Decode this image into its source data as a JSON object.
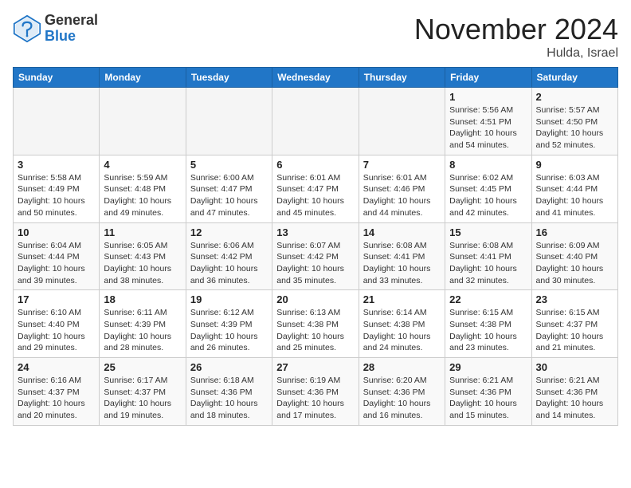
{
  "logo": {
    "general": "General",
    "blue": "Blue"
  },
  "title": "November 2024",
  "location": "Hulda, Israel",
  "days_of_week": [
    "Sunday",
    "Monday",
    "Tuesday",
    "Wednesday",
    "Thursday",
    "Friday",
    "Saturday"
  ],
  "weeks": [
    [
      {
        "day": "",
        "info": ""
      },
      {
        "day": "",
        "info": ""
      },
      {
        "day": "",
        "info": ""
      },
      {
        "day": "",
        "info": ""
      },
      {
        "day": "",
        "info": ""
      },
      {
        "day": "1",
        "info": "Sunrise: 5:56 AM\nSunset: 4:51 PM\nDaylight: 10 hours and 54 minutes."
      },
      {
        "day": "2",
        "info": "Sunrise: 5:57 AM\nSunset: 4:50 PM\nDaylight: 10 hours and 52 minutes."
      }
    ],
    [
      {
        "day": "3",
        "info": "Sunrise: 5:58 AM\nSunset: 4:49 PM\nDaylight: 10 hours and 50 minutes."
      },
      {
        "day": "4",
        "info": "Sunrise: 5:59 AM\nSunset: 4:48 PM\nDaylight: 10 hours and 49 minutes."
      },
      {
        "day": "5",
        "info": "Sunrise: 6:00 AM\nSunset: 4:47 PM\nDaylight: 10 hours and 47 minutes."
      },
      {
        "day": "6",
        "info": "Sunrise: 6:01 AM\nSunset: 4:47 PM\nDaylight: 10 hours and 45 minutes."
      },
      {
        "day": "7",
        "info": "Sunrise: 6:01 AM\nSunset: 4:46 PM\nDaylight: 10 hours and 44 minutes."
      },
      {
        "day": "8",
        "info": "Sunrise: 6:02 AM\nSunset: 4:45 PM\nDaylight: 10 hours and 42 minutes."
      },
      {
        "day": "9",
        "info": "Sunrise: 6:03 AM\nSunset: 4:44 PM\nDaylight: 10 hours and 41 minutes."
      }
    ],
    [
      {
        "day": "10",
        "info": "Sunrise: 6:04 AM\nSunset: 4:44 PM\nDaylight: 10 hours and 39 minutes."
      },
      {
        "day": "11",
        "info": "Sunrise: 6:05 AM\nSunset: 4:43 PM\nDaylight: 10 hours and 38 minutes."
      },
      {
        "day": "12",
        "info": "Sunrise: 6:06 AM\nSunset: 4:42 PM\nDaylight: 10 hours and 36 minutes."
      },
      {
        "day": "13",
        "info": "Sunrise: 6:07 AM\nSunset: 4:42 PM\nDaylight: 10 hours and 35 minutes."
      },
      {
        "day": "14",
        "info": "Sunrise: 6:08 AM\nSunset: 4:41 PM\nDaylight: 10 hours and 33 minutes."
      },
      {
        "day": "15",
        "info": "Sunrise: 6:08 AM\nSunset: 4:41 PM\nDaylight: 10 hours and 32 minutes."
      },
      {
        "day": "16",
        "info": "Sunrise: 6:09 AM\nSunset: 4:40 PM\nDaylight: 10 hours and 30 minutes."
      }
    ],
    [
      {
        "day": "17",
        "info": "Sunrise: 6:10 AM\nSunset: 4:40 PM\nDaylight: 10 hours and 29 minutes."
      },
      {
        "day": "18",
        "info": "Sunrise: 6:11 AM\nSunset: 4:39 PM\nDaylight: 10 hours and 28 minutes."
      },
      {
        "day": "19",
        "info": "Sunrise: 6:12 AM\nSunset: 4:39 PM\nDaylight: 10 hours and 26 minutes."
      },
      {
        "day": "20",
        "info": "Sunrise: 6:13 AM\nSunset: 4:38 PM\nDaylight: 10 hours and 25 minutes."
      },
      {
        "day": "21",
        "info": "Sunrise: 6:14 AM\nSunset: 4:38 PM\nDaylight: 10 hours and 24 minutes."
      },
      {
        "day": "22",
        "info": "Sunrise: 6:15 AM\nSunset: 4:38 PM\nDaylight: 10 hours and 23 minutes."
      },
      {
        "day": "23",
        "info": "Sunrise: 6:15 AM\nSunset: 4:37 PM\nDaylight: 10 hours and 21 minutes."
      }
    ],
    [
      {
        "day": "24",
        "info": "Sunrise: 6:16 AM\nSunset: 4:37 PM\nDaylight: 10 hours and 20 minutes."
      },
      {
        "day": "25",
        "info": "Sunrise: 6:17 AM\nSunset: 4:37 PM\nDaylight: 10 hours and 19 minutes."
      },
      {
        "day": "26",
        "info": "Sunrise: 6:18 AM\nSunset: 4:36 PM\nDaylight: 10 hours and 18 minutes."
      },
      {
        "day": "27",
        "info": "Sunrise: 6:19 AM\nSunset: 4:36 PM\nDaylight: 10 hours and 17 minutes."
      },
      {
        "day": "28",
        "info": "Sunrise: 6:20 AM\nSunset: 4:36 PM\nDaylight: 10 hours and 16 minutes."
      },
      {
        "day": "29",
        "info": "Sunrise: 6:21 AM\nSunset: 4:36 PM\nDaylight: 10 hours and 15 minutes."
      },
      {
        "day": "30",
        "info": "Sunrise: 6:21 AM\nSunset: 4:36 PM\nDaylight: 10 hours and 14 minutes."
      }
    ]
  ]
}
